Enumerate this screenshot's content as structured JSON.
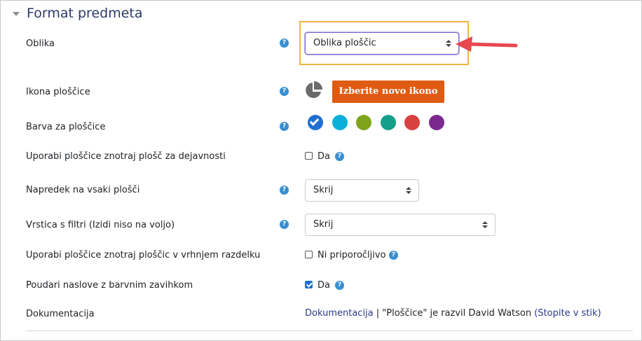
{
  "section": {
    "title": "Format predmeta"
  },
  "rows": {
    "oblika": {
      "label": "Oblika",
      "value": "Oblika ploščic"
    },
    "ikona": {
      "label": "Ikona ploščice",
      "button": "Izberite novo ikono"
    },
    "barva": {
      "label": "Barva za ploščice"
    },
    "uporabi_dejavnosti": {
      "label": "Uporabi ploščice znotraj plošč za dejavnosti",
      "checkbox_label": "Da",
      "checked": false
    },
    "napredek": {
      "label": "Napredek na vsaki plošči",
      "value": "Skrij"
    },
    "vrstica": {
      "label": "Vrstica s filtri (Izidi niso na voljo)",
      "value": "Skrij"
    },
    "uporabi_vrhnjem": {
      "label": "Uporabi ploščice znotraj ploščic v vrhnjem razdelku",
      "checkbox_label": "Ni priporočljivo",
      "checked": false
    },
    "poudari": {
      "label": "Poudari naslove z barvnim zavihkom",
      "checkbox_label": "Da",
      "checked": true
    },
    "dokumentacija": {
      "label": "Dokumentacija",
      "link1": "Dokumentacija",
      "sep": " | ",
      "text": "\"Ploščice\" je razvil David Watson",
      "link2": "(Stopite v stik)"
    }
  },
  "help_glyph": "?",
  "colors": {
    "swatches": [
      "#1f6fd0",
      "#0bb0d8",
      "#7fa31a",
      "#139f8a",
      "#d94040",
      "#7a2a8e"
    ],
    "selected_swatch": 0,
    "accent_button": "#e05b12",
    "highlight": "#f0b43c",
    "arrow": "#e8474f"
  }
}
